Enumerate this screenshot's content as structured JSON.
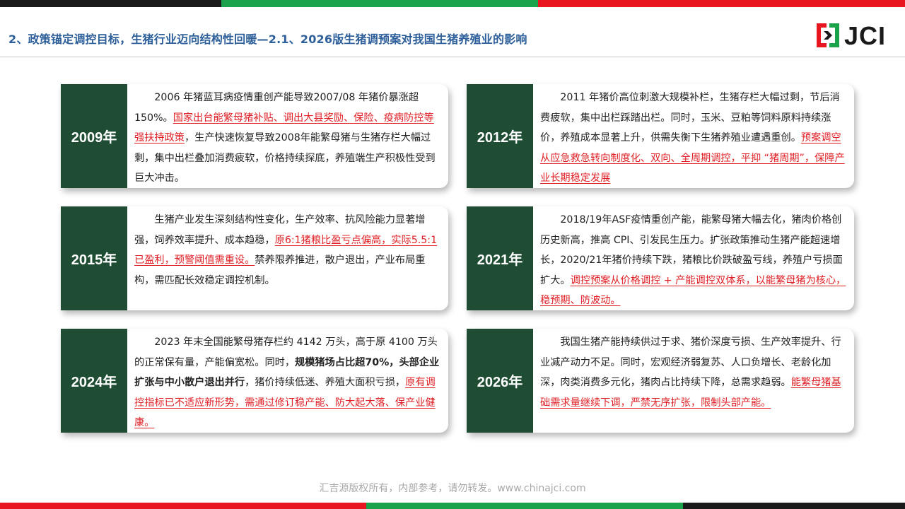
{
  "header": {
    "title": "2、政策锚定调控目标，生猪行业迈向结构性回暖—2.1、2026版生猪调预案对我国生猪养殖业的影响",
    "logo_text": "JCI"
  },
  "colors": {
    "green_dark": "#1f4d33",
    "highlight_red": "#e01f25",
    "title_blue": "#2d5f9a",
    "bar_green": "#1aa34a",
    "bar_red": "#e8161e",
    "bar_black": "#1a1a1a"
  },
  "cards": [
    {
      "year": "2009年",
      "p1": "2006 年猪蓝耳病疫情重创产能导致2007/08 年猪价暴涨超150%。",
      "h1": "国家出台能繁母猪补贴、调出大县奖励、保险、疫病防控等强扶持政策",
      "p2": "，生产快速恢复导致2008年能繁母猪与生猪存栏大幅过剩，集中出栏叠加消费疲软，价格持续探底，养殖端生产积极性受到巨大冲击。"
    },
    {
      "year": "2012年",
      "p1": "2011 年猪价高位刺激大规模补栏，生猪存栏大幅过剩，节后消费疲软，集中出栏踩踏出栏。同时，玉米、豆粕等饲料原料持续涨价，养殖成本显著上升，供需失衡下生猪养殖业遭遇重创。",
      "h1": "预案调空从应急救急转向制度化、双向、全周期调控，平抑 “猪周期”，保障产业长期稳定发展"
    },
    {
      "year": "2015年",
      "p1": "生猪产业发生深刻结构性变化，生产效率、抗风险能力显著增强，饲养效率提升、成本趋稳，",
      "h1": "原6:1猪粮比盈亏点偏高，实际5.5:1已盈利，预警阈值需重设。",
      "p2": "禁养限养推进，散户退出，产业布局重构，需匹配长效稳定调控机制。"
    },
    {
      "year": "2021年",
      "p1": "2018/19年ASF疫情重创产能，能繁母猪大幅去化，猪肉价格创历史新高，推高 CPI、引发民生压力。扩张政策推动生猪产能超速增长，2020/21年猪价持续下跌，猪粮比价跌破盈亏线，养殖户亏损面扩大。",
      "h1": "调控预案从价格调控 + 产能调控双体系，以能繁母猪为核心，稳预期、防波动。"
    },
    {
      "year": "2024年",
      "p1": "2023 年末全国能繁母猪存栏约 4142 万头，高于原 4100 万头的正常保有量，产能偏宽松。同时，",
      "b1": "规模猪场占比超70%，头部企业扩张与中小散户退出并行",
      "p2": "，猪价持续低迷、养殖大面积亏损，",
      "h1": "原有调控指标已不适应新形势，需通过修订稳产能、防大起大落、保产业健康。"
    },
    {
      "year": "2026年",
      "p1": "我国生猪产能持续供过于求、猪价深度亏损、生产效率提升、行业减产动力不足。同时，宏观经济弱复苏、人口负增长、老龄化加深，肉类消费多元化，猪肉占比持续下降，总需求趋弱。",
      "h1": "能繁母猪基础需求量继续下调，严禁无序扩张，限制头部产能。"
    }
  ],
  "footer": {
    "text": "汇吉源版权所有，内部参考，请勿转发。www.chinajci.com"
  }
}
